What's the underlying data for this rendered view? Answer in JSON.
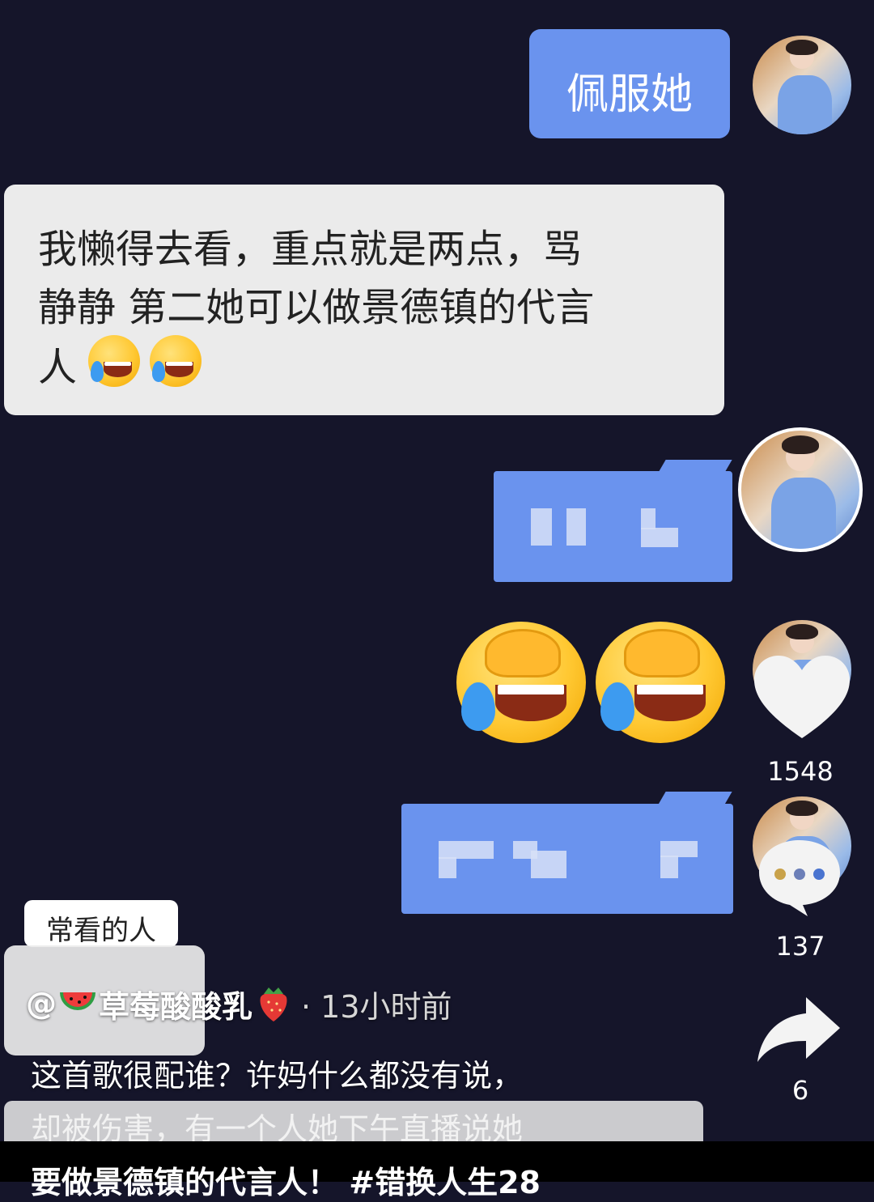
{
  "messages": {
    "msg1": "佩服她",
    "msg2_line1": "我懒得去看，重点就是两点，骂",
    "msg2_line2": "静静  第二她可以做景德镇的代言",
    "msg2_line3": "人"
  },
  "frequent_label": "常看的人",
  "actions": {
    "like_count": "1548",
    "comment_count": "137",
    "share_count": "6"
  },
  "caption": {
    "at_symbol": "@",
    "author": "草莓酸酸乳",
    "time": "· 13小时前",
    "line1": "这首歌很配谁？许妈什么都没有说，",
    "line2": "却被伤害，有一个人她下午直播说她",
    "line3": "要做景德镇的代言人！ #错换人生28"
  },
  "icons": [
    "avatar",
    "laugh-cry-emoji",
    "facepalm-emoji",
    "heart-icon",
    "comment-icon",
    "share-icon",
    "watermelon-emoji",
    "strawberry-emoji"
  ]
}
